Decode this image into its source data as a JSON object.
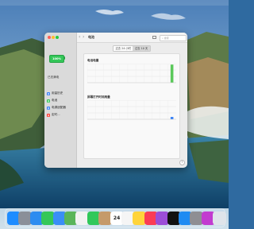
{
  "window": {
    "title": "电池",
    "back_arrow": "‹",
    "forward_arrow": "›",
    "search_placeholder": "搜索"
  },
  "sidebar": {
    "battery_percent": "100%",
    "status": "已充满电",
    "items": [
      {
        "label": "用量历史",
        "icon": "battery-history-icon",
        "color": "#3b82f6"
      },
      {
        "label": "电池",
        "icon": "battery-icon",
        "color": "#34c759"
      },
      {
        "label": "电源适配器",
        "icon": "power-adapter-icon",
        "color": "#3b82f6"
      },
      {
        "label": "定时...",
        "icon": "schedule-icon",
        "color": "#ff3b30"
      }
    ]
  },
  "tabs": [
    {
      "label": "过去 24 小时",
      "selected": false
    },
    {
      "label": "过去 10 天",
      "selected": true
    }
  ],
  "charts": {
    "battery_level": {
      "title": "电池电量"
    },
    "screen_on_usage": {
      "title": "屏幕打开时间用量"
    }
  },
  "chart_data": [
    {
      "type": "bar",
      "title": "电池电量",
      "categories": [
        "",
        "",
        "",
        "",
        "",
        "",
        "",
        "",
        "",
        "",
        ""
      ],
      "values": [
        0,
        0,
        0,
        0,
        0,
        0,
        0,
        0,
        0,
        0,
        95
      ],
      "tick_labels": [
        "",
        "",
        "",
        "",
        "",
        "",
        "",
        "",
        "",
        "",
        "",
        ""
      ],
      "ylim": [
        0,
        100
      ],
      "color": "#5ac85a"
    },
    {
      "type": "bar",
      "title": "屏幕打开时间用量",
      "categories": [
        "",
        "",
        "",
        "",
        "",
        "",
        "",
        "",
        "",
        "",
        ""
      ],
      "values": [
        0,
        0,
        0,
        0,
        0,
        0,
        0,
        0,
        0,
        0,
        12
      ],
      "tick_labels": [
        "",
        "",
        "",
        "",
        "",
        "",
        "",
        "",
        "",
        "",
        "",
        ""
      ],
      "ylim": [
        0,
        100
      ],
      "color": "#2f7cf6"
    }
  ],
  "help": "?",
  "dock": [
    {
      "name": "finder-icon",
      "color": "#1e8cff"
    },
    {
      "name": "launchpad-icon",
      "color": "#8a8f99"
    },
    {
      "name": "safari-icon",
      "color": "#2d8cf0"
    },
    {
      "name": "messages-icon",
      "color": "#34c759"
    },
    {
      "name": "mail-icon",
      "color": "#3a8ef6"
    },
    {
      "name": "maps-icon",
      "color": "#5ab55a"
    },
    {
      "name": "photos-icon",
      "color": "#f2f2f2"
    },
    {
      "name": "facetime-icon",
      "color": "#30c85a"
    },
    {
      "name": "contacts-icon",
      "color": "#c59a6a"
    },
    {
      "name": "calendar-icon",
      "color": "#ffffff",
      "text": "24"
    },
    {
      "name": "reminders-icon",
      "color": "#f5f5f5"
    },
    {
      "name": "notes-icon",
      "color": "#ffd43b"
    },
    {
      "name": "music-icon",
      "color": "#fa3c55"
    },
    {
      "name": "podcasts-icon",
      "color": "#9b4dd8"
    },
    {
      "name": "tv-icon",
      "color": "#111111"
    },
    {
      "name": "app-store-icon",
      "color": "#1f8bf2"
    },
    {
      "name": "system-preferences-icon",
      "color": "#8e8e93"
    },
    {
      "name": "app-icon",
      "color": "#c23bd0"
    },
    {
      "name": "trash-icon",
      "color": "#dfe4ea"
    }
  ]
}
